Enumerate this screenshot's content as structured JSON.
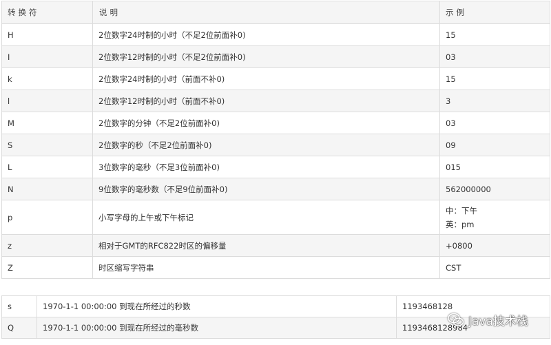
{
  "main_table": {
    "headers": [
      "转换符",
      "说明",
      "示例"
    ],
    "rows": [
      {
        "code": "H",
        "desc": "2位数字24时制的小时（不足2位前面补0)",
        "example": [
          "15"
        ]
      },
      {
        "code": "I",
        "desc": "2位数字12时制的小时（不足2位前面补0)",
        "example": [
          "03"
        ]
      },
      {
        "code": "k",
        "desc": "2位数字24时制的小时（前面不补0)",
        "example": [
          "15"
        ]
      },
      {
        "code": "l",
        "desc": "2位数字12时制的小时（前面不补0)",
        "example": [
          "3"
        ]
      },
      {
        "code": "M",
        "desc": "2位数字的分钟（不足2位前面补0)",
        "example": [
          "03"
        ]
      },
      {
        "code": "S",
        "desc": "2位数字的秒（不足2位前面补0)",
        "example": [
          "09"
        ]
      },
      {
        "code": "L",
        "desc": "3位数字的毫秒（不足3位前面补0)",
        "example": [
          "015"
        ]
      },
      {
        "code": "N",
        "desc": "9位数字的毫秒数（不足9位前面补0)",
        "example": [
          "562000000"
        ]
      },
      {
        "code": "p",
        "desc": "小写字母的上午或下午标记",
        "example": [
          "中：下午",
          "英：pm"
        ]
      },
      {
        "code": "z",
        "desc": "相对于GMT的RFC822时区的偏移量",
        "example": [
          "+0800"
        ]
      },
      {
        "code": "Z",
        "desc": "时区缩写字符串",
        "example": [
          "CST"
        ]
      }
    ]
  },
  "secondary_table": {
    "rows": [
      {
        "code": "s",
        "desc": "1970-1-1 00:00:00 到现在所经过的秒数",
        "value": "1193468128"
      },
      {
        "code": "Q",
        "desc": "1970-1-1 00:00:00 到现在所经过的毫秒数",
        "value": "1193468128984"
      }
    ]
  },
  "watermark": {
    "text": "Java技术栈",
    "icon": "wechat-icon"
  }
}
